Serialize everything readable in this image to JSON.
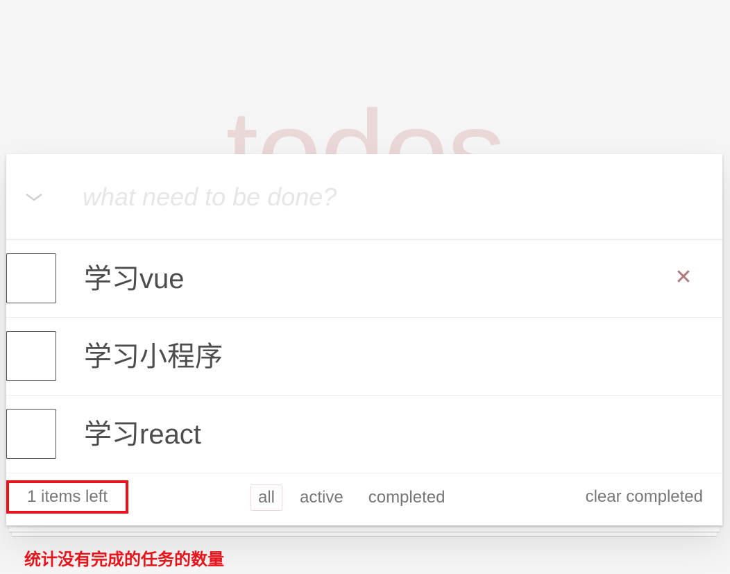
{
  "header": {
    "title": "todos"
  },
  "new_todo": {
    "placeholder": "what need to be done?"
  },
  "todos": [
    {
      "label": "学习vue",
      "completed": false
    },
    {
      "label": "学习小程序",
      "completed": false
    },
    {
      "label": "学习react",
      "completed": false
    }
  ],
  "footer": {
    "count_text": "1 items left",
    "filters": [
      "all",
      "active",
      "completed"
    ],
    "selected_filter": "all",
    "clear_label": "clear completed"
  },
  "annotation": "统计没有完成的任务的数量",
  "colors": {
    "highlight": "#e8141b",
    "title": "#eadcdc",
    "destroy": "#b07a7a"
  },
  "icons": {
    "toggle_all": "chevron-down-icon",
    "destroy": "close-icon"
  }
}
